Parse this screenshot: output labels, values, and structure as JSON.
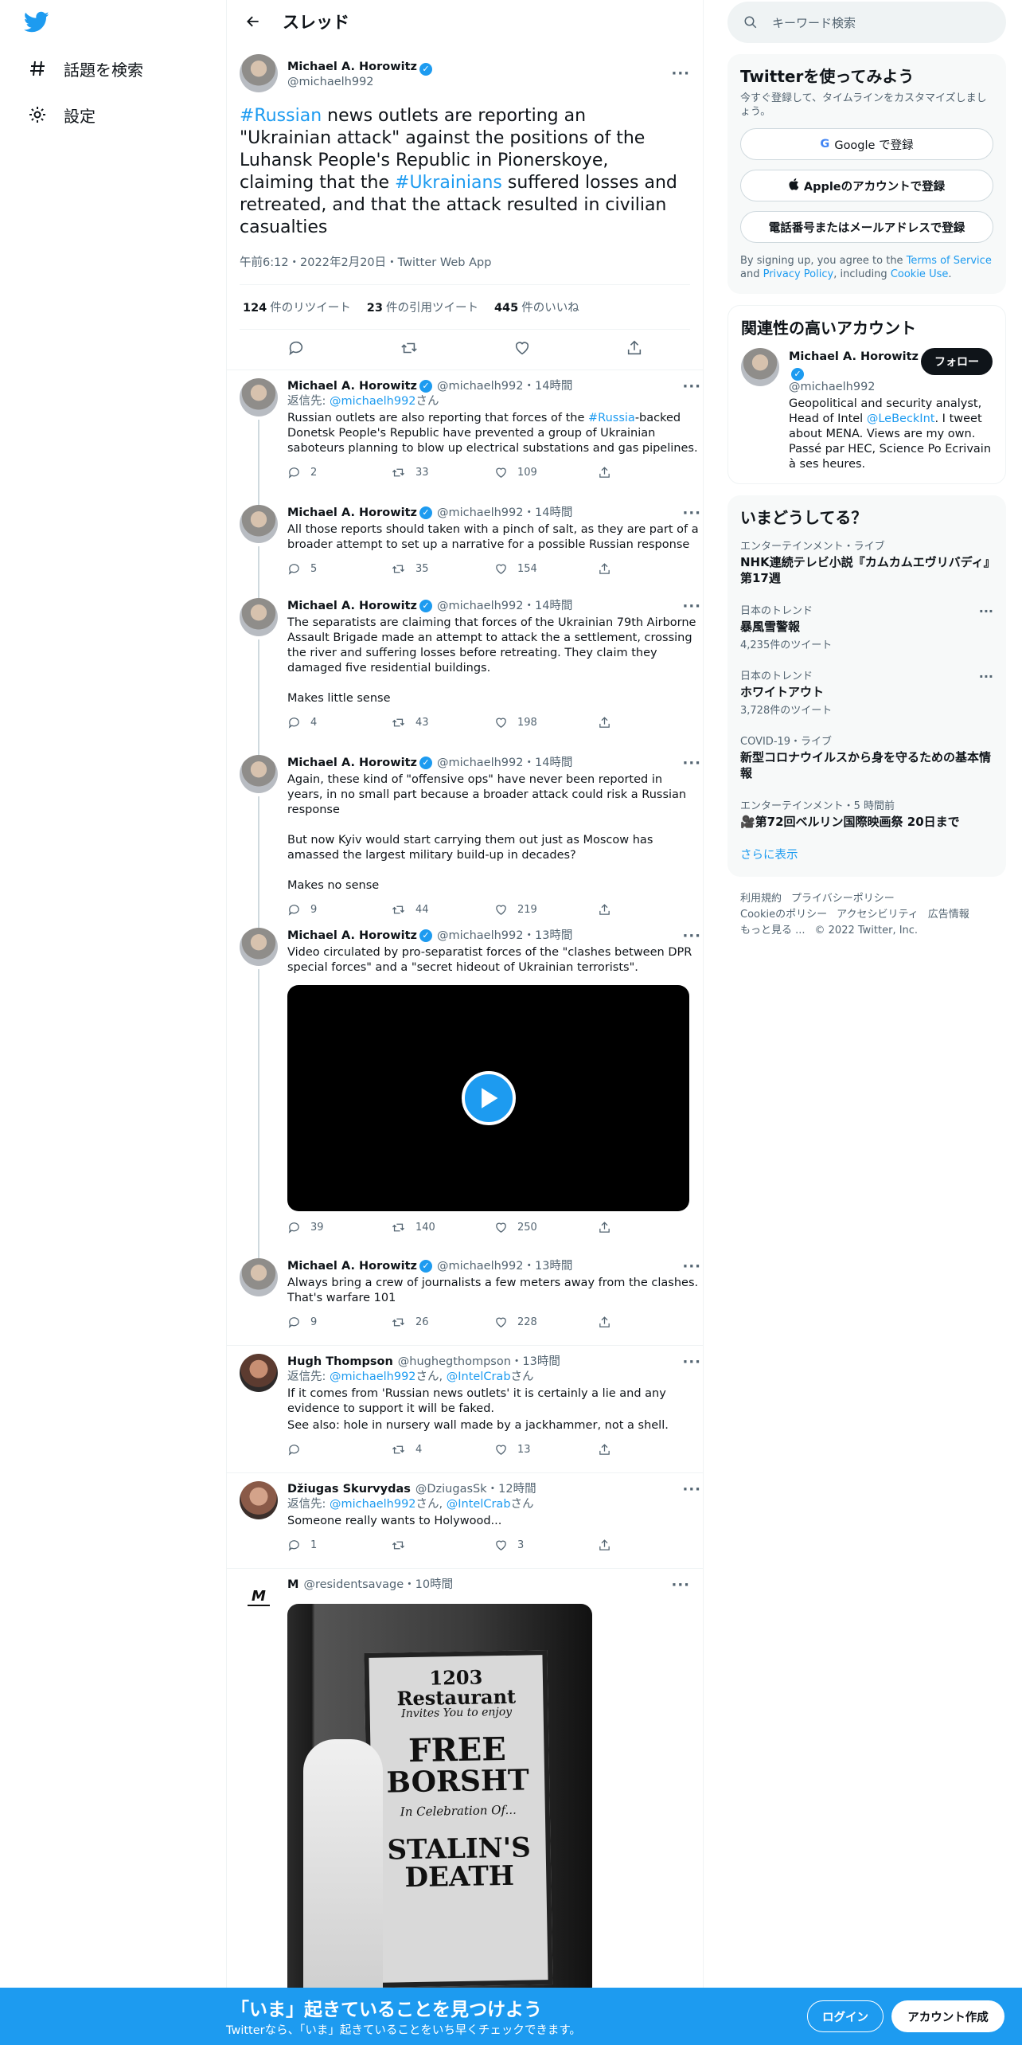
{
  "nav": {
    "explore": "話題を検索",
    "settings": "設定"
  },
  "header": {
    "title": "スレッド"
  },
  "main_tweet": {
    "name": "Michael A. Horowitz",
    "handle": "@michaelh992",
    "text_parts": [
      "#Russian",
      " news outlets are reporting an \"Ukrainian attack\" against the positions of the Luhansk People's Republic in Pionerskoye, claiming that the ",
      "#Ukrainians",
      " suffered losses and retreated, and that the attack resulted in civilian casualties"
    ],
    "meta": "午前6:12・2022年2月20日・Twitter Web App",
    "retweets": "124",
    "retweets_label": "件のリツイート",
    "quotes": "23",
    "quotes_label": "件の引用ツイート",
    "likes": "445",
    "likes_label": "件のいいね"
  },
  "replies": [
    {
      "name": "Michael A. Horowitz",
      "handle": "@michaelh992",
      "time": "14時間",
      "reply_prefix": "返信先: ",
      "reply_to": [
        "@michaelh992"
      ],
      "text": [
        "Russian outlets are also reporting that forces of the ",
        "#Russia",
        "-backed Donetsk People's Republic have prevented a group of Ukrainian saboteurs planning to blow up electrical substations and gas pipelines."
      ],
      "replies": "2",
      "retweets": "33",
      "likes": "109"
    },
    {
      "name": "Michael A. Horowitz",
      "handle": "@michaelh992",
      "time": "14時間",
      "text": "All those reports should taken with a pinch of salt, as they are part of a broader attempt to set up a narrative for a possible Russian response",
      "replies": "5",
      "retweets": "35",
      "likes": "154"
    },
    {
      "name": "Michael A. Horowitz",
      "handle": "@michaelh992",
      "time": "14時間",
      "text": "The separatists are claiming that forces of the Ukrainian 79th Airborne Assault Brigade made an attempt to attack the a settlement, crossing the river and suffering losses before retreating. They claim they damaged five residential buildings.",
      "text2": "Makes little sense",
      "replies": "4",
      "retweets": "43",
      "likes": "198"
    },
    {
      "name": "Michael A. Horowitz",
      "handle": "@michaelh992",
      "time": "14時間",
      "text": "Again, these kind of \"offensive ops\" have never been reported in years, in no small part because a broader attack could risk a Russian response",
      "text2": "But now Kyiv would start carrying them out just as Moscow has amassed the largest military build-up in decades?",
      "text3": "Makes no sense",
      "replies": "9",
      "retweets": "44",
      "likes": "219"
    },
    {
      "name": "Michael A. Horowitz",
      "handle": "@michaelh992",
      "time": "13時間",
      "text": "Video circulated by pro-separatist forces of the \"clashes between DPR special forces\" and a \"secret hideout of Ukrainian terrorists\".",
      "replies": "39",
      "retweets": "140",
      "likes": "250"
    },
    {
      "name": "Michael A. Horowitz",
      "handle": "@michaelh992",
      "time": "13時間",
      "text": "Always bring a crew of journalists a few meters away from the clashes. That's warfare 101",
      "replies": "9",
      "retweets": "26",
      "likes": "228"
    },
    {
      "name": "Hugh Thompson",
      "handle": "@hughegthompson",
      "time": "13時間",
      "reply_prefix": "返信先: ",
      "reply_to": [
        "@michaelh992",
        "@IntelCrab"
      ],
      "reply_suffix": "さん",
      "text": "If it comes from 'Russian news outlets' it is certainly a lie and any evidence to support it will be faked.",
      "text2": "See also: hole in nursery wall made by a jackhammer, not a shell.",
      "replies": "",
      "retweets": "4",
      "likes": "13"
    },
    {
      "name": "Džiugas Skurvydas",
      "handle": "@DziugasSk",
      "time": "12時間",
      "reply_prefix": "返信先: ",
      "reply_to": [
        "@michaelh992",
        "@IntelCrab"
      ],
      "text": "Someone really wants to Holywood...",
      "replies": "1",
      "retweets": "",
      "likes": "3"
    },
    {
      "name": "M",
      "handle": "@residentsavage",
      "time": "10時間"
    }
  ],
  "photo_sign": {
    "l1": "1203 Restaurant",
    "l2": "Invites You to enjoy",
    "l3": "FREE",
    "l4": "BORSHT",
    "l5": "In Celebration Of...",
    "l6": "STALIN'S",
    "l7": "DEATH"
  },
  "search": {
    "placeholder": "キーワード検索"
  },
  "signup": {
    "title": "Twitterを使ってみよう",
    "sub": "今すぐ登録して、タイムラインをカスタマイズしましょう。",
    "google": "Google で登録",
    "apple": "Appleのアカウントで登録",
    "phone": "電話番号またはメールアドレスで登録",
    "legal_1": "By signing up, you agree to the ",
    "terms": "Terms of Service",
    "legal_2": " and ",
    "privacy": "Privacy Policy",
    "legal_3": ", including ",
    "cookie": "Cookie Use",
    "legal_4": "."
  },
  "related": {
    "title": "関連性の高いアカウント",
    "name": "Michael A. Horowitz",
    "handle": "@michaelh992",
    "follow": "フォロー",
    "bio_1": "Geopolitical and security analyst, Head of Intel ",
    "bio_link": "@LeBeckInt",
    "bio_2": ". I tweet about MENA. Views are my own. Passé par HEC, Science Po Ecrivain à ses heures."
  },
  "trends": {
    "title": "いまどうしてる？",
    "items": [
      {
        "cat": "エンターテインメント・ライブ",
        "ttl": "NHK連続テレビ小説『カムカムエヴリバディ』第17週",
        "cnt": ""
      },
      {
        "cat": "日本のトレンド",
        "ttl": "暴風雪警報",
        "cnt": "4,235件のツイート"
      },
      {
        "cat": "日本のトレンド",
        "ttl": "ホワイトアウト",
        "cnt": "3,728件のツイート"
      },
      {
        "cat": "COVID-19・ライブ",
        "ttl": "新型コロナウイルスから身を守るための基本情報",
        "cnt": ""
      },
      {
        "cat": "エンターテインメント・5 時間前",
        "ttl": "🎥第72回ベルリン国際映画祭 20日まで",
        "cnt": ""
      }
    ],
    "more": "さらに表示"
  },
  "footer": {
    "l1": "利用規約",
    "l2": "プライバシーポリシー",
    "l3": "Cookieのポリシー",
    "l4": "アクセシビリティ",
    "l5": "広告情報",
    "l6": "もっと見る ...",
    "l7": "© 2022 Twitter, Inc."
  },
  "banner": {
    "heading": "「いま」起きていることを見つけよう",
    "sub": "Twitterなら、「いま」起きていることをいち早くチェックできます。",
    "login": "ログイン",
    "signup": "アカウント作成"
  },
  "colors": {
    "accent": "#1d9bf0",
    "text": "#0f1419",
    "muted": "#536471"
  }
}
